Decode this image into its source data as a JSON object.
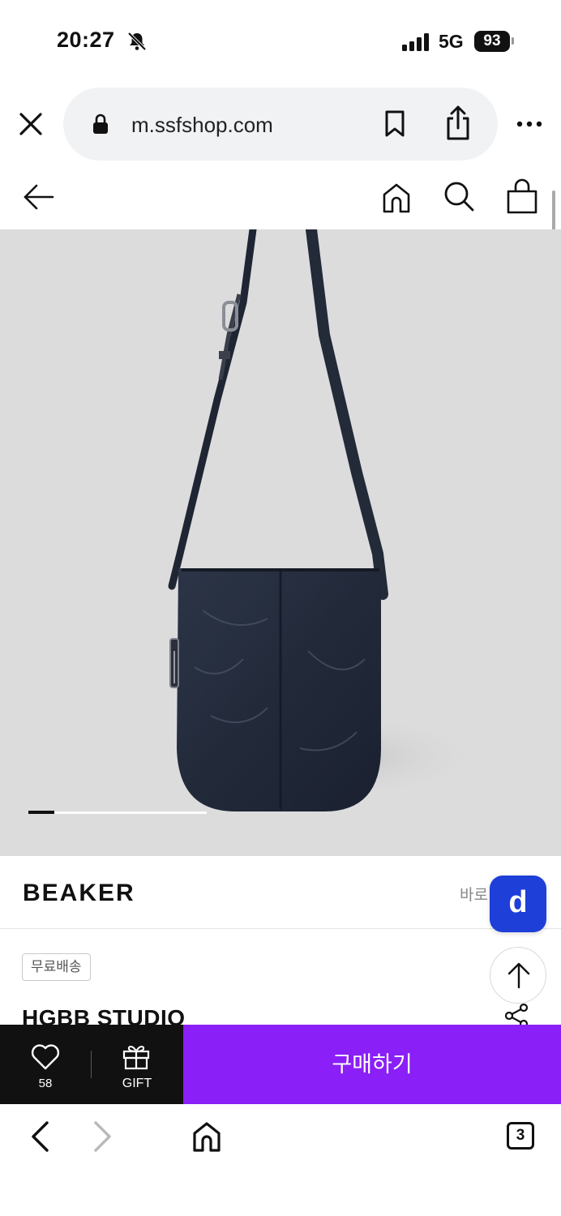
{
  "status_bar": {
    "time": "20:27",
    "network": "5G",
    "battery": "93",
    "icons": [
      "bell-muted-icon",
      "signal-icon"
    ]
  },
  "browser": {
    "url": "m.ssfshop.com",
    "icons": [
      "close-icon",
      "lock-icon",
      "bookmark-icon",
      "share-icon",
      "more-icon"
    ]
  },
  "site_header": {
    "icons": [
      "back-arrow-icon",
      "home-icon",
      "search-icon",
      "bag-icon"
    ]
  },
  "product": {
    "image": "navy crossbody bag photo",
    "slider": {
      "current": 1,
      "progress": 0.15
    },
    "brand": "BEAKER",
    "brand_link": "바로",
    "badge": "무료배송",
    "title": "HGBB STUDIO"
  },
  "floating": {
    "d_label": "d",
    "top_icon": "arrow-up-icon"
  },
  "purchase_bar": {
    "like_count": "58",
    "gift_label": "GIFT",
    "buy_label": "구매하기",
    "colors": {
      "dark": "#111111",
      "buy": "#8b1ff7"
    }
  },
  "bottom_nav": {
    "tab_count": "3",
    "icons": [
      "chevron-left-icon",
      "chevron-right-icon",
      "home-icon",
      "tabs-icon"
    ]
  }
}
